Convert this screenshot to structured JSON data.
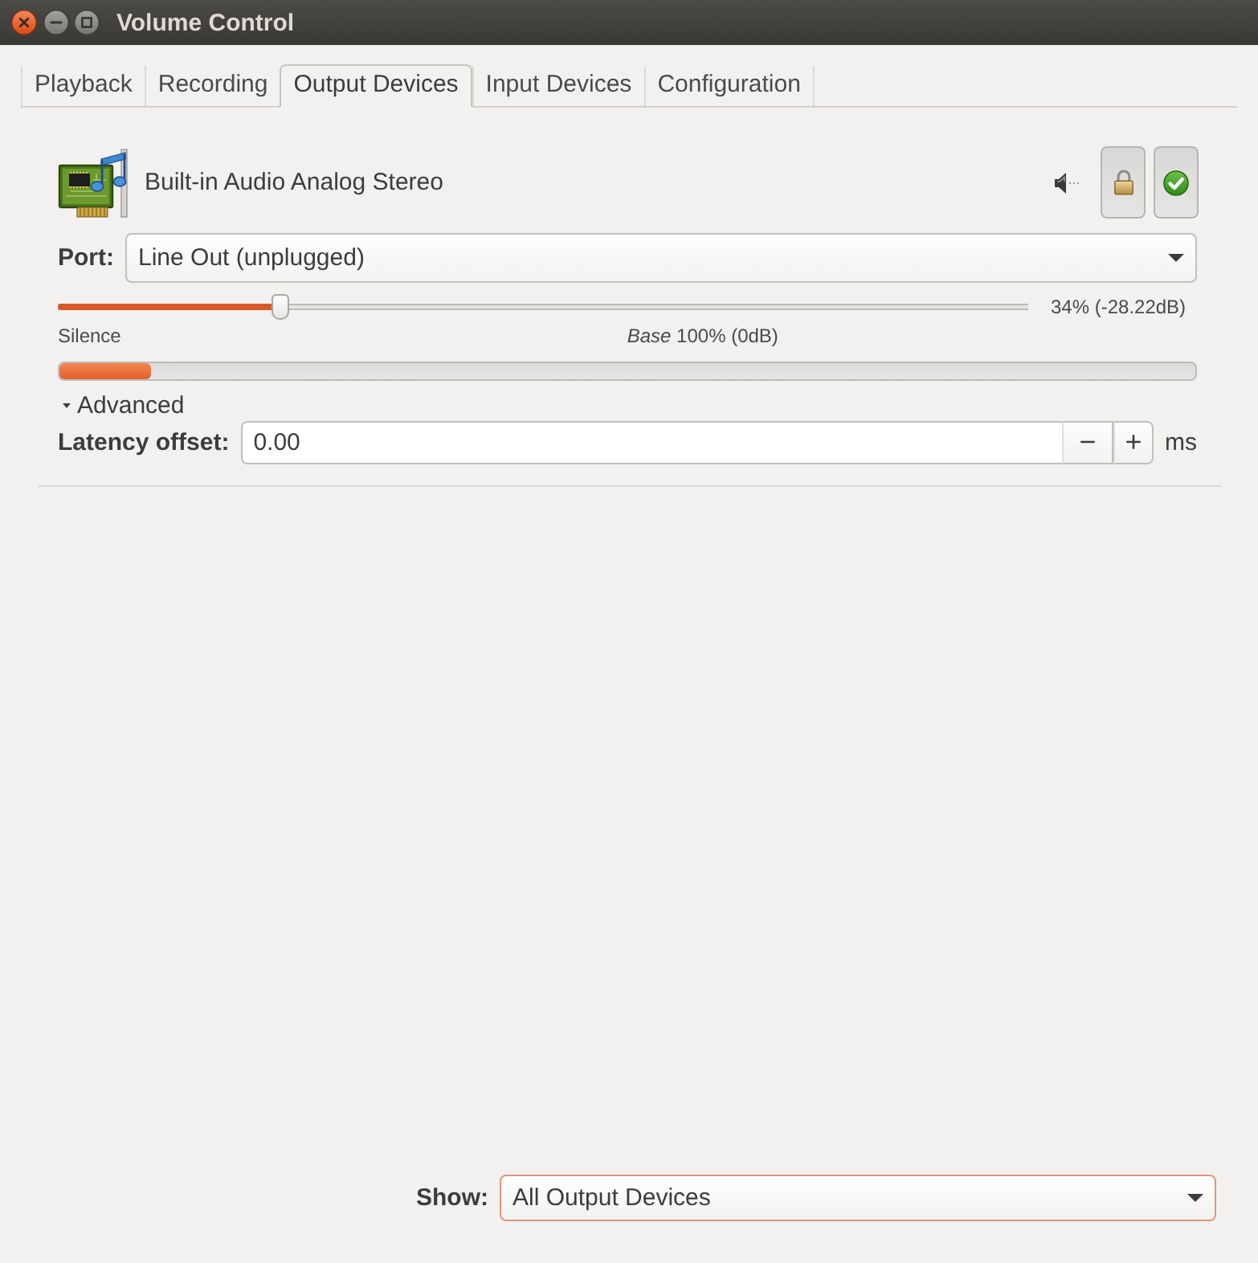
{
  "window": {
    "title": "Volume Control"
  },
  "tabs": [
    {
      "label": "Playback",
      "selected": false
    },
    {
      "label": "Recording",
      "selected": false
    },
    {
      "label": "Output Devices",
      "selected": true
    },
    {
      "label": "Input Devices",
      "selected": false
    },
    {
      "label": "Configuration",
      "selected": false
    }
  ],
  "device": {
    "name": "Built-in Audio Analog Stereo",
    "muted": false,
    "locked": true,
    "fallback": true,
    "port": {
      "label": "Port:",
      "value": "Line Out (unplugged)"
    },
    "volume": {
      "level": 0.23,
      "reading": "34% (-28.22dB)"
    },
    "scale_marks": [
      "Silence",
      "*Base* 100% (0dB)"
    ],
    "meter": {
      "level": 0.08
    },
    "advanced": {
      "label": "Advanced",
      "expanded": true
    },
    "latency": {
      "label": "Latency offset:",
      "value": "0.00",
      "decrement": "−",
      "increment": "+",
      "unit": "ms"
    }
  },
  "footer": {
    "show": {
      "label": "Show:",
      "value": "All Output Devices"
    }
  }
}
